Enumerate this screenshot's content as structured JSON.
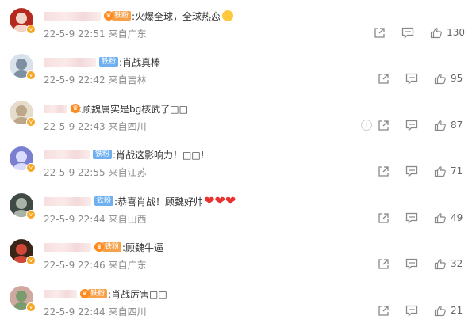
{
  "comments": [
    {
      "avatar": {
        "bg": "#b42a1f",
        "inner": "#f3d6c8"
      },
      "badge": {
        "type": "crown-orange",
        "label": "铁粉"
      },
      "text": ":火爆全球，全球热恋",
      "date": "22-5-9 22:51",
      "location": "来自广东",
      "likes": "130",
      "extra_emoji": "face"
    },
    {
      "avatar": {
        "bg": "#d9e2ea",
        "inner": "#7d8fa0"
      },
      "badge": {
        "type": "blue",
        "label": "铁粉"
      },
      "text": ":肖战真棒",
      "date": "22-5-9 22:42",
      "location": "来自吉林",
      "likes": "95"
    },
    {
      "avatar": {
        "bg": "#e6dccb",
        "inner": "#bca78a"
      },
      "badge": {
        "type": "crown-only",
        "label": ""
      },
      "text": ":顾魏属实是bg核武了□□",
      "date": "22-5-9 22:43",
      "location": "来自四川",
      "likes": "87",
      "show_info": true
    },
    {
      "avatar": {
        "bg": "#7a7fd0",
        "inner": "#d9dcff"
      },
      "badge": {
        "type": "blue",
        "label": "铁粉"
      },
      "text": ":肖战这影响力！□□!",
      "date": "22-5-9 22:55",
      "location": "来自江苏",
      "likes": "71"
    },
    {
      "avatar": {
        "bg": "#3f4a45",
        "inner": "#a9b3a7"
      },
      "badge": {
        "type": "blue",
        "label": "铁粉"
      },
      "text": ":恭喜肖战！顾魏好帅",
      "date": "22-5-9 22:44",
      "location": "来自山西",
      "likes": "49",
      "hearts": "❤❤❤"
    },
    {
      "avatar": {
        "bg": "#3a2418",
        "inner": "#d1473a"
      },
      "badge": {
        "type": "crown-orange",
        "label": "铁粉"
      },
      "text": ":顾魏牛逼",
      "date": "22-5-9 22:46",
      "location": "来自广东",
      "likes": "32"
    },
    {
      "avatar": {
        "bg": "#cfa8a0",
        "inner": "#7a9b6e"
      },
      "badge": {
        "type": "crown-orange",
        "label": "铁粉"
      },
      "text": ":肖战厉害□□",
      "date": "22-5-9 22:44",
      "location": "来自四川",
      "likes": "21"
    }
  ]
}
